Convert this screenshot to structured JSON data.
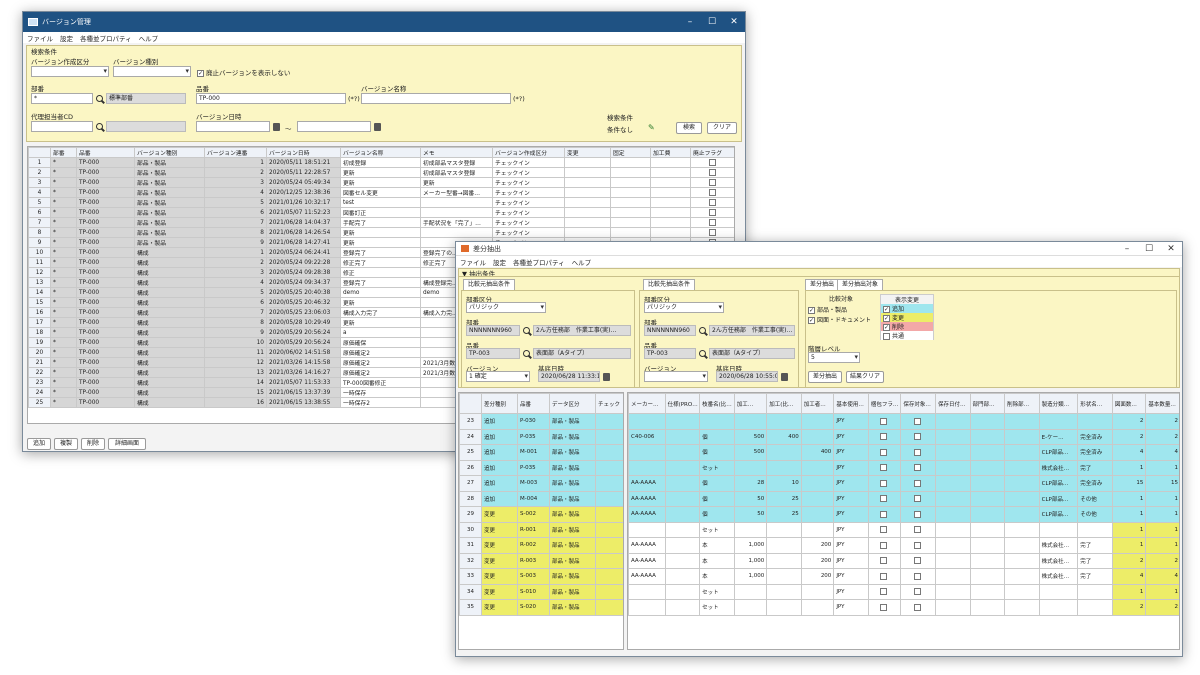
{
  "w1": {
    "title": "バージョン管理",
    "menu": [
      "ファイル",
      "設定",
      "各種並プロパティ",
      "ヘルプ"
    ],
    "cond": {
      "title": "検索条件",
      "kubun_label": "バージョン作成区分",
      "shubetsu_label": "バージョン種別",
      "checkbox": "廃止バージョンを表示しない",
      "buban_label": "部番",
      "buban_value": "*",
      "buban_name": "標準部番",
      "hinban_label": "品番",
      "hinban_value": "TP-000",
      "hinban_note": "(*?)",
      "vname_label": "バージョン名称",
      "vname_note": "(*?)",
      "daiko_label": "代理担当者CD",
      "vdate_label": "バージョン日時",
      "tilde": "～",
      "kensaku_label": "検索条件",
      "kensaku_value": "条件なし",
      "search_btn": "検索",
      "clear_btn": "クリア"
    },
    "grid": {
      "headers": [
        "",
        "部番",
        "品番",
        "バージョン種別",
        "バージョン連番",
        "バージョン日時",
        "バージョン名称",
        "メモ",
        "バージョン作成区分",
        "変更",
        "固定",
        "加工費",
        "廃止フラグ"
      ],
      "rows": [
        [
          "1",
          "*",
          "TP-000",
          "部品・製品",
          "1",
          "2020/05/11 18:51:21",
          "初成登録",
          "初成部品マスタ登録",
          "チェックイン"
        ],
        [
          "2",
          "*",
          "TP-000",
          "部品・製品",
          "2",
          "2020/05/11 22:28:57",
          "更新",
          "初成部品マスタ登録",
          "チェックイン"
        ],
        [
          "3",
          "*",
          "TP-000",
          "部品・製品",
          "3",
          "2020/05/24 05:49:34",
          "更新",
          "更新",
          "チェックイン"
        ],
        [
          "4",
          "*",
          "TP-000",
          "部品・製品",
          "4",
          "2020/12/25 12:38:36",
          "図番セル変更",
          "メーカー型番→図番…",
          "チェックイン"
        ],
        [
          "5",
          "*",
          "TP-000",
          "部品・製品",
          "5",
          "2021/01/26 10:32:17",
          "test",
          "",
          "チェックイン"
        ],
        [
          "6",
          "*",
          "TP-000",
          "部品・製品",
          "6",
          "2021/05/07 11:52:23",
          "図番訂正",
          "",
          "チェックイン"
        ],
        [
          "7",
          "*",
          "TP-000",
          "部品・製品",
          "7",
          "2021/06/28 14:04:37",
          "手配完了",
          "手配状況を「完了」…",
          "チェックイン"
        ],
        [
          "8",
          "*",
          "TP-000",
          "部品・製品",
          "8",
          "2021/06/28 14:26:54",
          "更新",
          "",
          "チェックイン"
        ],
        [
          "9",
          "*",
          "TP-000",
          "部品・製品",
          "9",
          "2021/06/28 14:27:41",
          "更新",
          "",
          "チェックイン"
        ],
        [
          "10",
          "*",
          "TP-000",
          "構成",
          "1",
          "2020/05/24 06:24:41",
          "登録完了",
          "登録完了の…",
          ""
        ],
        [
          "11",
          "*",
          "TP-000",
          "構成",
          "2",
          "2020/05/24 09:22:28",
          "修正完了",
          "修正完了",
          ""
        ],
        [
          "12",
          "*",
          "TP-000",
          "構成",
          "3",
          "2020/05/24 09:28:38",
          "修正",
          "",
          ""
        ],
        [
          "13",
          "*",
          "TP-000",
          "構成",
          "4",
          "2020/05/24 09:34:37",
          "登録完了",
          "構成登録完…",
          ""
        ],
        [
          "14",
          "*",
          "TP-000",
          "構成",
          "5",
          "2020/05/25 20:40:38",
          "demo",
          "demo",
          ""
        ],
        [
          "15",
          "*",
          "TP-000",
          "構成",
          "6",
          "2020/05/25 20:46:32",
          "更新",
          "",
          ""
        ],
        [
          "16",
          "*",
          "TP-000",
          "構成",
          "7",
          "2020/05/25 23:06:03",
          "構成入力完了",
          "構成入力完…",
          ""
        ],
        [
          "17",
          "*",
          "TP-000",
          "構成",
          "8",
          "2020/05/28 10:29:49",
          "更新",
          "",
          ""
        ],
        [
          "18",
          "*",
          "TP-000",
          "構成",
          "9",
          "2020/05/29 20:56:24",
          "a",
          "",
          ""
        ],
        [
          "19",
          "*",
          "TP-000",
          "構成",
          "10",
          "2020/05/29 20:56:24",
          "原価確保",
          "",
          ""
        ],
        [
          "20",
          "*",
          "TP-000",
          "構成",
          "11",
          "2020/06/02 14:51:58",
          "原価確定2",
          "",
          ""
        ],
        [
          "21",
          "*",
          "TP-000",
          "構成",
          "12",
          "2021/03/26 14:15:58",
          "原価確定2",
          "2021/3月数",
          ""
        ],
        [
          "22",
          "*",
          "TP-000",
          "構成",
          "13",
          "2021/03/26 14:16:27",
          "原価確定2",
          "2021/3月数",
          ""
        ],
        [
          "23",
          "*",
          "TP-000",
          "構成",
          "14",
          "2021/05/07 11:53:33",
          "TP-000図番修正",
          "",
          ""
        ],
        [
          "24",
          "*",
          "TP-000",
          "構成",
          "15",
          "2021/06/15 13:37:39",
          "一時保存",
          "",
          ""
        ],
        [
          "25",
          "*",
          "TP-000",
          "構成",
          "16",
          "2021/06/15 13:38:55",
          "一時保存2",
          "",
          ""
        ]
      ]
    },
    "footer": [
      "追加",
      "複製",
      "削除",
      "詳細画面"
    ]
  },
  "w2": {
    "title": "差分抽出",
    "menu": [
      "ファイル",
      "設定",
      "各種並プロパティ",
      "ヘルプ"
    ],
    "cond": "▼ 抽出条件",
    "left": {
      "tab": "比較元抽出条件",
      "kubun_label": "部番区分",
      "kubun_value": "パリジック",
      "buban_label": "部番",
      "buban_value": "NNNNNNN960",
      "buban_name": "2ん方任務部　作業工事(実)…",
      "hinban_label": "品番",
      "hinban_value": "TP-003",
      "hinban_name": "表面部（Aタイプ）",
      "ver_label": "バージョン",
      "ver_value": "1 確定",
      "date_label": "基底日時",
      "date_value": "2020/06/28 11:33:13"
    },
    "right": {
      "tab": "比較先抽出条件",
      "kubun_label": "部番区分",
      "kubun_value": "パリジック",
      "buban_label": "部番",
      "buban_value": "NNNNNNN960",
      "buban_name": "2ん方任務部　作業工事(実)…",
      "hinban_label": "品番",
      "hinban_value": "TP-003",
      "hinban_name": "表面部（Aタイプ）",
      "ver_label": "バージョン",
      "date_label": "基底日時",
      "date_value": "2020/06/28 10:55:06"
    },
    "tabs": [
      "差分抽出",
      "差分抽出対象"
    ],
    "hikaku": {
      "title": "比較対象",
      "items": [
        "部品・製品",
        "図面・ドキュメント"
      ]
    },
    "hyoji": {
      "title": "表示変更",
      "items": [
        "追加",
        "変更",
        "削除",
        "共通"
      ],
      "colors": [
        "#9fe6ee",
        "#eded68",
        "#f3a8a8",
        "#ffffff"
      ]
    },
    "level_label": "階層レベル",
    "level_value": "5",
    "btn_diff": "差分抽出",
    "btn_clear": "結果クリア",
    "lgrid": {
      "headers": [
        "",
        "差分種別",
        "品番",
        "データ区分",
        "チェック"
      ],
      "rows": [
        [
          "23",
          "追加",
          "P-030",
          "部品・製品"
        ],
        [
          "24",
          "追加",
          "P-035",
          "部品・製品"
        ],
        [
          "25",
          "追加",
          "M-001",
          "部品・製品"
        ],
        [
          "26",
          "追加",
          "P-035",
          "部品・製品"
        ],
        [
          "27",
          "追加",
          "M-003",
          "部品・製品"
        ],
        [
          "28",
          "追加",
          "M-004",
          "部品・製品"
        ],
        [
          "29",
          "変更",
          "S-002",
          "部品・製品"
        ],
        [
          "30",
          "変更",
          "R-001",
          "部品・製品"
        ],
        [
          "31",
          "変更",
          "R-002",
          "部品・製品"
        ],
        [
          "32",
          "変更",
          "R-003",
          "部品・製品"
        ],
        [
          "33",
          "変更",
          "S-003",
          "部品・製品"
        ],
        [
          "34",
          "変更",
          "S-010",
          "部品・製品"
        ],
        [
          "35",
          "変更",
          "S-020",
          "部品・製品"
        ]
      ]
    },
    "rgrid": {
      "headers": [
        "メーカー…",
        "仕様(PRO…",
        "枝番名(比…",
        "加工…",
        "加工(比…",
        "加工者…",
        "基本使用…",
        "梱包フラ…",
        "保存対象…",
        "保存日付…",
        "部門部…",
        "削除部…",
        "製造分類…",
        "形状名…",
        "図面数…",
        "基本数量…"
      ],
      "rows": [
        [
          "",
          "",
          "",
          "",
          "",
          "",
          "JPY",
          "",
          "",
          "",
          "",
          "",
          "",
          "",
          "2",
          "2"
        ],
        [
          "C40-006",
          "",
          "個",
          "500",
          "400",
          "",
          "JPY",
          "",
          "",
          "",
          "",
          "",
          "E-ケー…",
          "完全済み",
          "2",
          "2"
        ],
        [
          "",
          "",
          "個",
          "500",
          "",
          "400",
          "JPY",
          "",
          "",
          "",
          "",
          "",
          "CLP部品…",
          "完全済み",
          "4",
          "4"
        ],
        [
          "",
          "",
          "セット",
          "",
          "",
          "",
          "JPY",
          "",
          "",
          "",
          "",
          "",
          "株式会社…",
          "完了",
          "1",
          "1"
        ],
        [
          "AA-AAAA",
          "",
          "個",
          "28",
          "10",
          "",
          "JPY",
          "",
          "",
          "",
          "",
          "",
          "CLP部品…",
          "完全済み",
          "15",
          "15"
        ],
        [
          "AA-AAAA",
          "",
          "個",
          "50",
          "25",
          "",
          "JPY",
          "",
          "",
          "",
          "",
          "",
          "CLP部品…",
          "その他",
          "1",
          "1"
        ],
        [
          "AA-AAAA",
          "",
          "個",
          "50",
          "25",
          "",
          "JPY",
          "",
          "",
          "",
          "",
          "",
          "CLP部品…",
          "その他",
          "1",
          "1"
        ],
        [
          "",
          "",
          "セット",
          "",
          "",
          "",
          "JPY",
          "",
          "",
          "",
          "",
          "",
          "",
          "",
          "1",
          "1"
        ],
        [
          "AA-AAAA",
          "",
          "本",
          "1,000",
          "",
          "200",
          "JPY",
          "",
          "",
          "",
          "",
          "",
          "株式会社…",
          "完了",
          "1",
          "1"
        ],
        [
          "AA-AAAA",
          "",
          "本",
          "1,000",
          "",
          "200",
          "JPY",
          "",
          "",
          "",
          "",
          "",
          "株式会社…",
          "完了",
          "2",
          "2"
        ],
        [
          "AA-AAAA",
          "",
          "本",
          "1,000",
          "",
          "200",
          "JPY",
          "",
          "",
          "",
          "",
          "",
          "株式会社…",
          "完了",
          "4",
          "4"
        ],
        [
          "",
          "",
          "セット",
          "",
          "",
          "",
          "JPY",
          "",
          "",
          "",
          "",
          "",
          "",
          "",
          "1",
          "1"
        ],
        [
          "",
          "",
          "セット",
          "",
          "",
          "",
          "JPY",
          "",
          "",
          "",
          "",
          "",
          "",
          "",
          "2",
          "2"
        ]
      ]
    }
  }
}
